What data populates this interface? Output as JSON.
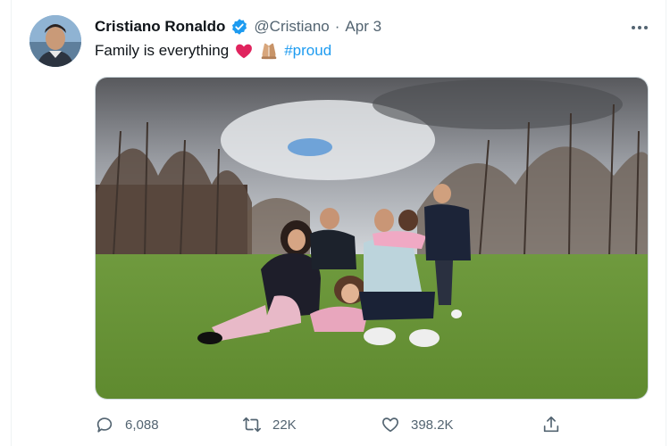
{
  "tweet": {
    "author_name": "Cristiano Ronaldo",
    "handle": "@Cristiano",
    "separator": "·",
    "date": "Apr 3",
    "text": "Family is everything",
    "hashtag": "#proud",
    "emojis": [
      "red-heart",
      "folded-hands"
    ]
  },
  "actions": {
    "replies": "6,088",
    "retweets": "22K",
    "likes": "398.2K"
  },
  "colors": {
    "accent": "#1d9bf0",
    "muted_text": "#536471",
    "heart": "#e0245e"
  },
  "icons": [
    "more-icon",
    "verified-badge-icon",
    "reply-icon",
    "retweet-icon",
    "like-icon",
    "share-icon"
  ]
}
